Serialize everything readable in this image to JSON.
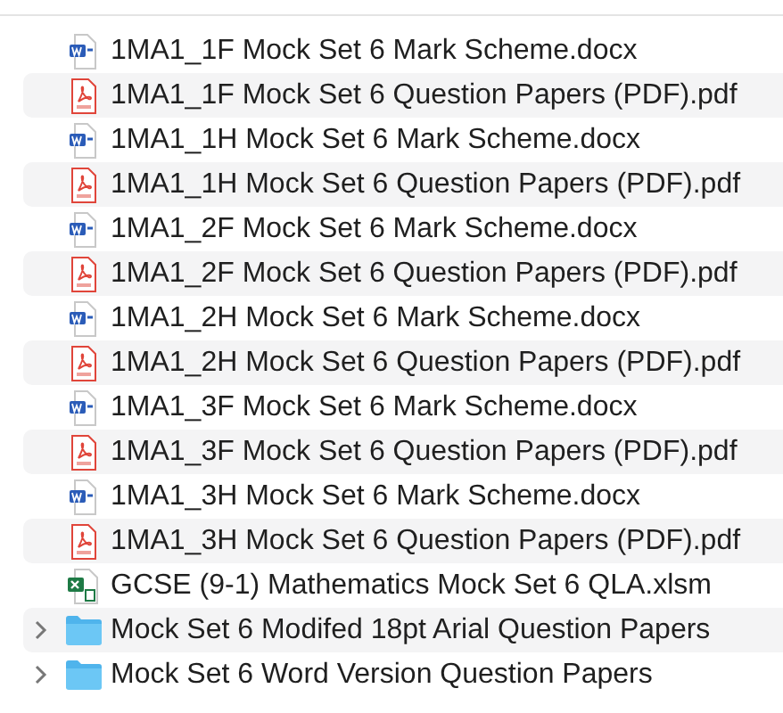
{
  "files": [
    {
      "kind": "word",
      "name": "1MA1_1F Mock Set 6 Mark Scheme.docx"
    },
    {
      "kind": "pdf",
      "name": "1MA1_1F Mock Set 6 Question Papers (PDF).pdf"
    },
    {
      "kind": "word",
      "name": "1MA1_1H Mock Set 6 Mark Scheme.docx"
    },
    {
      "kind": "pdf",
      "name": "1MA1_1H Mock Set 6 Question Papers (PDF).pdf"
    },
    {
      "kind": "word",
      "name": "1MA1_2F Mock Set 6 Mark Scheme.docx"
    },
    {
      "kind": "pdf",
      "name": "1MA1_2F Mock Set 6 Question Papers (PDF).pdf"
    },
    {
      "kind": "word",
      "name": "1MA1_2H Mock Set 6 Mark Scheme.docx"
    },
    {
      "kind": "pdf",
      "name": "1MA1_2H Mock Set 6 Question Papers (PDF).pdf"
    },
    {
      "kind": "word",
      "name": "1MA1_3F Mock Set 6 Mark Scheme.docx"
    },
    {
      "kind": "pdf",
      "name": "1MA1_3F Mock Set 6 Question Papers (PDF).pdf"
    },
    {
      "kind": "word",
      "name": "1MA1_3H Mock Set 6 Mark Scheme.docx"
    },
    {
      "kind": "pdf",
      "name": "1MA1_3H Mock Set 6 Question Papers (PDF).pdf"
    },
    {
      "kind": "excel",
      "name": "GCSE (9-1) Mathematics Mock Set 6 QLA.xlsm"
    },
    {
      "kind": "folder",
      "name": "Mock Set 6 Modifed 18pt Arial Question Papers",
      "expanded": false
    },
    {
      "kind": "folder",
      "name": "Mock Set 6 Word Version Question Papers",
      "expanded": false
    }
  ]
}
